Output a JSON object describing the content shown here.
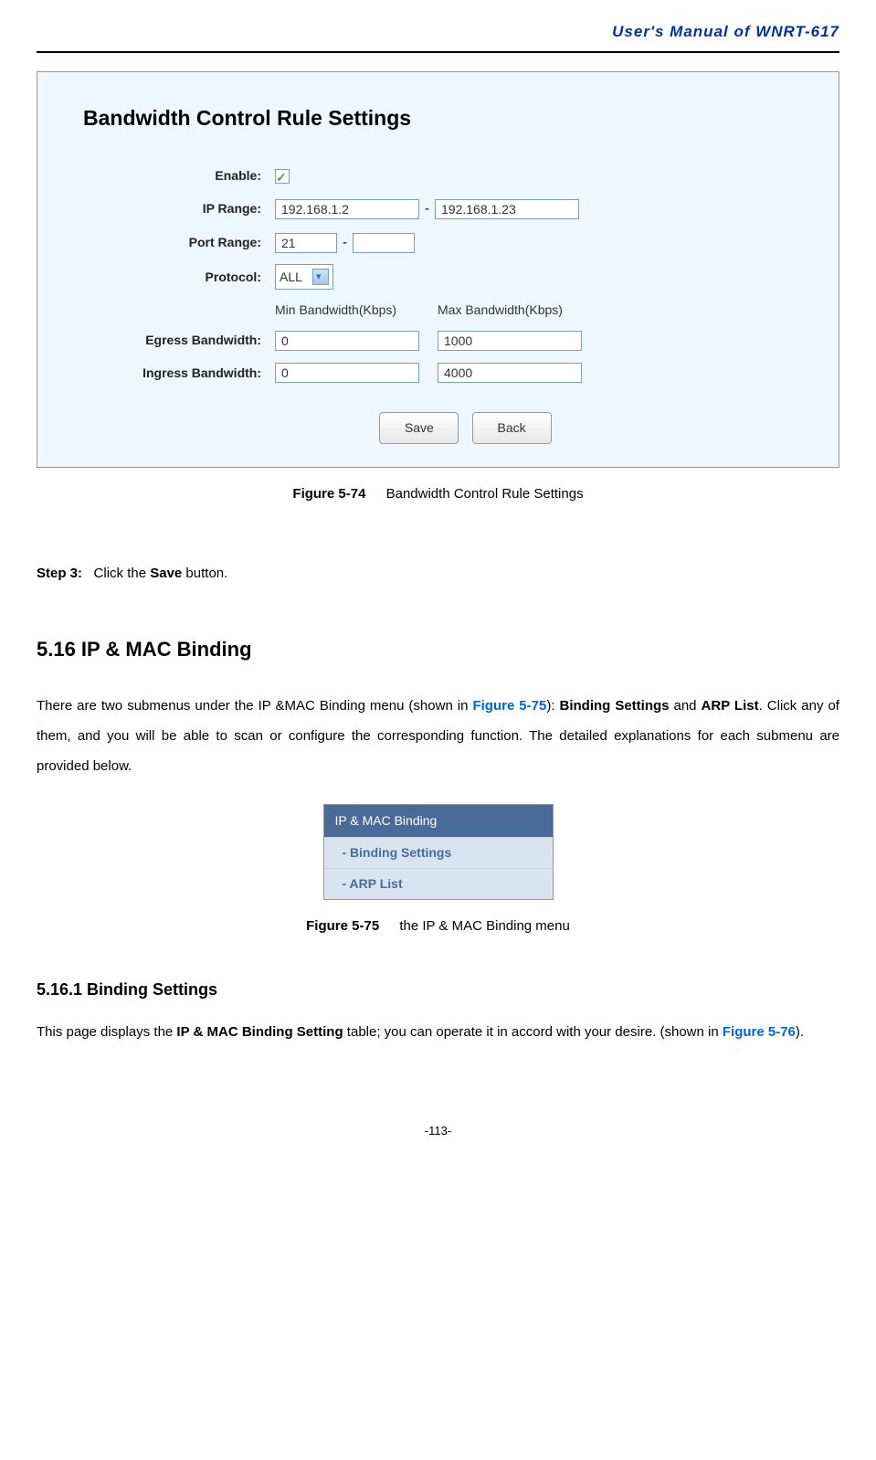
{
  "header": {
    "title": "User's Manual of WNRT-617"
  },
  "screenshot1": {
    "title": "Bandwidth Control Rule Settings",
    "labels": {
      "enable": "Enable:",
      "ip_range": "IP Range:",
      "port_range": "Port Range:",
      "protocol": "Protocol:",
      "egress": "Egress Bandwidth:",
      "ingress": "Ingress Bandwidth:"
    },
    "values": {
      "ip_start": "192.168.1.2",
      "ip_end": "192.168.1.23",
      "port_start": "21",
      "port_end": "",
      "protocol": "ALL",
      "egress_min": "0",
      "egress_max": "1000",
      "ingress_min": "0",
      "ingress_max": "4000"
    },
    "col_headers": {
      "min": "Min Bandwidth(Kbps)",
      "max": "Max Bandwidth(Kbps)"
    },
    "buttons": {
      "save": "Save",
      "back": "Back"
    }
  },
  "caption1": {
    "label": "Figure 5-74",
    "text": "Bandwidth Control Rule Settings"
  },
  "step3": {
    "label": "Step 3:",
    "text_prefix": "Click the ",
    "bold": "Save",
    "text_suffix": " button."
  },
  "section516": {
    "heading": "5.16  IP & MAC Binding",
    "p1_a": "There are two submenus under the IP &MAC Binding menu (shown in ",
    "p1_ref": "Figure 5-75",
    "p1_b": "): ",
    "p1_bold1": "Binding Settings",
    "p1_c": " and ",
    "p1_bold2": "ARP List",
    "p1_d": ". Click any of them, and you will be able to scan or configure the corresponding function. The detailed explanations for each submenu are provided below."
  },
  "menu": {
    "header": "IP & MAC Binding",
    "item1": "- Binding Settings",
    "item2": "- ARP List"
  },
  "caption2": {
    "label": "Figure 5-75",
    "text": "the IP & MAC Binding menu"
  },
  "section5161": {
    "heading": "5.16.1   Binding Settings",
    "p1_a": "This page displays the ",
    "p1_bold": "IP & MAC Binding Setting",
    "p1_b": " table; you can operate it in accord with your desire. (shown in ",
    "p1_ref": "Figure 5-76",
    "p1_c": ")."
  },
  "page_number": "-113-"
}
